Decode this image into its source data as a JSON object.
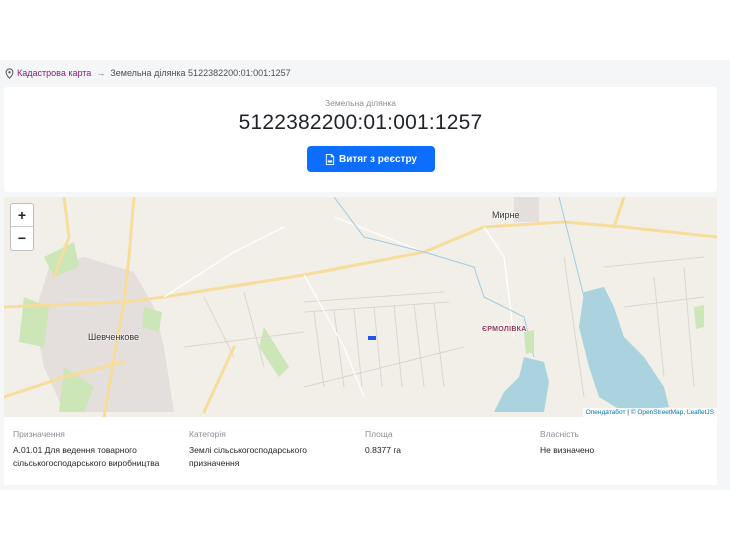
{
  "breadcrumb": {
    "root": "Кадастрова карта",
    "separator": "→",
    "current": "Земельна ділянка 5122382200:01:001:1257"
  },
  "parcel": {
    "label": "Земельна ділянка",
    "cadastral_number": "5122382200:01:001:1257",
    "extract_button": "Витяг з реєстру"
  },
  "map": {
    "zoom_in": "+",
    "zoom_out": "−",
    "places": {
      "town": "Шевченкове",
      "village1": "Мирне",
      "village2": "ЄРМОЛІВКА"
    },
    "attribution": {
      "provider": "Опендатабот",
      "osm": "© OpenStreetMap",
      "leaflet": "LeafletJS",
      "sep": "|",
      "comma": ","
    },
    "colors": {
      "parcel": "#2255ee",
      "water": "#aad3df",
      "road": "#f7dd9b"
    }
  },
  "details": {
    "purpose": {
      "title": "Призначення",
      "value": "А.01.01 Для ведення товарного сільськогосподарського виробництва"
    },
    "category": {
      "title": "Категорія",
      "value": "Землі сільськогосподарського призначення"
    },
    "area": {
      "title": "Площа",
      "value": "0.8377 га"
    },
    "ownership": {
      "title": "Власність",
      "value": "Не визначено"
    }
  }
}
